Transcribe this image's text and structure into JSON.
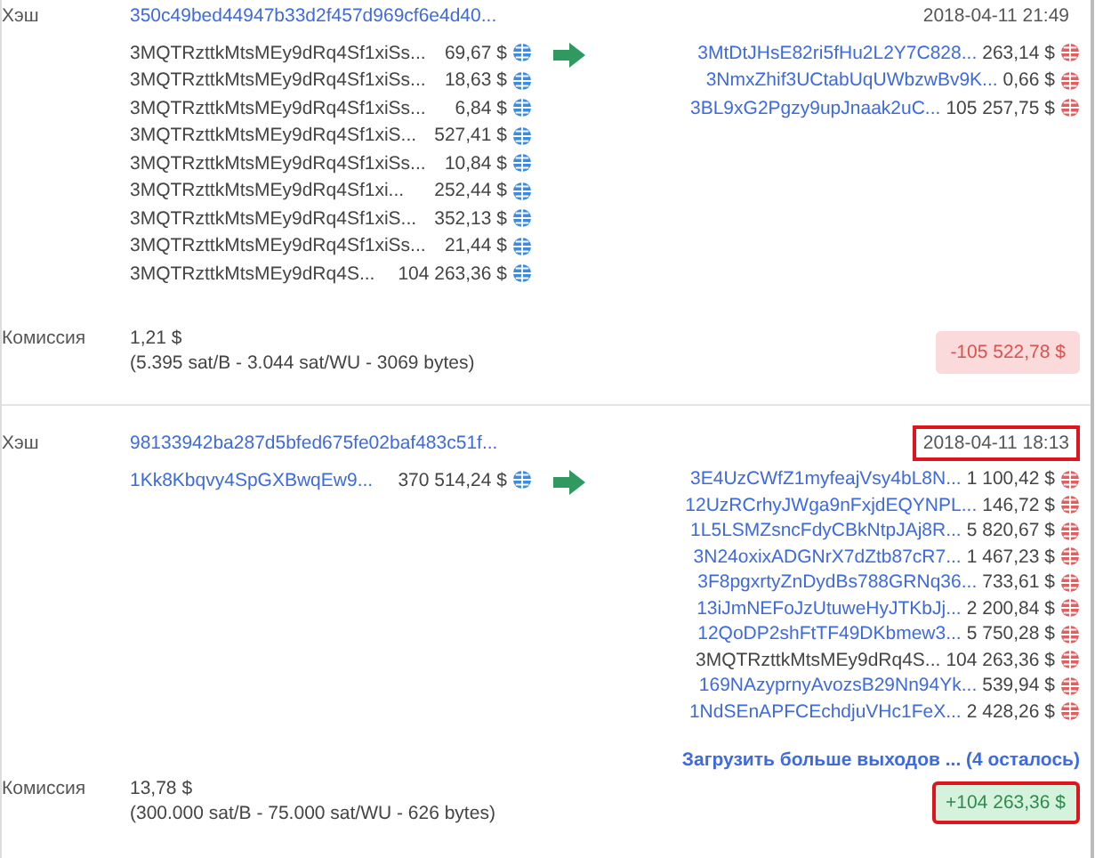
{
  "transactions": [
    {
      "hash_label": "Хэш",
      "hash": "350c49bed44947b33d2f457d969cf6e4d40...",
      "date": "2018-04-11 21:49",
      "date_highlighted": false,
      "inputs": [
        {
          "address": "3MQTRzttkMtsMEy9dRq4Sf1xiSs...",
          "kind": "own",
          "amount": "69,67 $",
          "spent": false
        },
        {
          "address": "3MQTRzttkMtsMEy9dRq4Sf1xiSs...",
          "kind": "own",
          "amount": "18,63 $",
          "spent": false
        },
        {
          "address": "3MQTRzttkMtsMEy9dRq4Sf1xiSs...",
          "kind": "own",
          "amount": "6,84 $",
          "spent": false
        },
        {
          "address": "3MQTRzttkMtsMEy9dRq4Sf1xiS...",
          "kind": "own",
          "amount": "527,41 $",
          "spent": false
        },
        {
          "address": "3MQTRzttkMtsMEy9dRq4Sf1xiSs...",
          "kind": "own",
          "amount": "10,84 $",
          "spent": false
        },
        {
          "address": "3MQTRzttkMtsMEy9dRq4Sf1xi...",
          "kind": "own",
          "amount": "252,44 $",
          "spent": false
        },
        {
          "address": "3MQTRzttkMtsMEy9dRq4Sf1xiS...",
          "kind": "own",
          "amount": "352,13 $",
          "spent": false
        },
        {
          "address": "3MQTRzttkMtsMEy9dRq4Sf1xiSs...",
          "kind": "own",
          "amount": "21,44 $",
          "spent": false
        },
        {
          "address": "3MQTRzttkMtsMEy9dRq4S...",
          "kind": "own",
          "amount": "104 263,36 $",
          "spent": false
        }
      ],
      "outputs": [
        {
          "address": "3MtDtJHsE82ri5fHu2L2Y7C828...",
          "kind": "link",
          "amount": "263,14 $",
          "spent": true
        },
        {
          "address": "3NmxZhif3UCtabUqUWbzwBv9K...",
          "kind": "link",
          "amount": "0,66 $",
          "spent": true
        },
        {
          "address": "3BL9xG2Pgzy9upJnaak2uC...",
          "kind": "link",
          "amount": "105 257,75 $",
          "spent": true
        }
      ],
      "fee_label": "Комиссия",
      "fee": "1,21 $",
      "fee_detail": "(5.395 sat/B - 3.044 sat/WU - 3069 bytes)",
      "total": "-105 522,78 $",
      "total_positive": false,
      "total_highlighted": false
    },
    {
      "hash_label": "Хэш",
      "hash": "98133942ba287d5bfed675fe02baf483c51f...",
      "date": "2018-04-11 18:13",
      "date_highlighted": true,
      "inputs": [
        {
          "address": "1Kk8Kbqvy4SpGXBwqEw9...",
          "kind": "link",
          "amount": "370 514,24 $",
          "spent": false
        }
      ],
      "outputs": [
        {
          "address": "3E4UzCWfZ1myfeajVsy4bL8N...",
          "kind": "link",
          "amount": "1 100,42 $",
          "spent": true
        },
        {
          "address": "12UzRCrhyJWga9nFxjdEQYNPL...",
          "kind": "link",
          "amount": "146,72 $",
          "spent": true
        },
        {
          "address": "1L5LSMZsncFdyCBkNtpJAj8R...",
          "kind": "link",
          "amount": "5 820,67 $",
          "spent": true
        },
        {
          "address": "3N24oxixADGNrX7dZtb87cR7...",
          "kind": "link",
          "amount": "1 467,23 $",
          "spent": true
        },
        {
          "address": "3F8pgxrtyZnDydBs788GRNq36...",
          "kind": "link",
          "amount": "733,61 $",
          "spent": true
        },
        {
          "address": "13iJmNEFoJzUtuweHyJTKbJj...",
          "kind": "link",
          "amount": "2 200,84 $",
          "spent": true
        },
        {
          "address": "12QoDP2shFtTF49DKbmew3...",
          "kind": "link",
          "amount": "5 750,28 $",
          "spent": true
        },
        {
          "address": "3MQTRzttkMtsMEy9dRq4S...",
          "kind": "own",
          "amount": "104 263,36 $",
          "spent": true
        },
        {
          "address": "169NAzyprnyAvozsB29Nn94Yk...",
          "kind": "link",
          "amount": "539,94 $",
          "spent": true
        },
        {
          "address": "1NdSEnAPFCEchdjuVHc1FeX...",
          "kind": "link",
          "amount": "2 428,26 $",
          "spent": true
        }
      ],
      "load_more": "Загрузить больше выходов ... (4 осталось)",
      "fee_label": "Комиссия",
      "fee": "13,78 $",
      "fee_detail": "(300.000 sat/B - 75.000 sat/WU - 626 bytes)",
      "total": "+104 263,36 $",
      "total_positive": true,
      "total_highlighted": true
    }
  ]
}
